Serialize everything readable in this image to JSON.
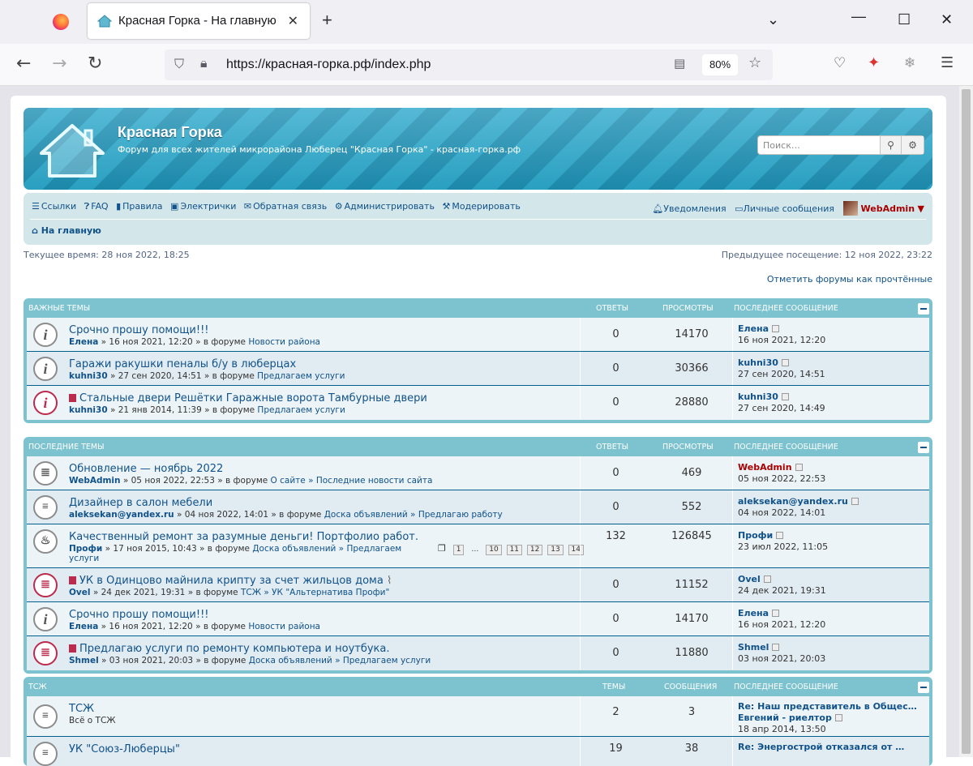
{
  "browser": {
    "tab_title": "Красная Горка - На главную",
    "url": "https://красная-горка.рф/index.php",
    "zoom": "80%"
  },
  "site": {
    "title": "Красная Горка",
    "description": "Форум для всех жителей микрорайона Люберец \"Красная Горка\" - красная-горка.рф",
    "search_placeholder": "Поиск…"
  },
  "nav": {
    "left": [
      "Ссылки",
      "FAQ",
      "Правила",
      "Электрички",
      "Обратная связь",
      "Администрировать",
      "Модерировать"
    ],
    "notifications": "Уведомления",
    "messages": "Личные сообщения",
    "user": "WebAdmin",
    "breadcrumb": "На главную"
  },
  "meta": {
    "current_time": "Текущее время: 28 ноя 2022, 18:25",
    "last_visit": "Предыдущее посещение: 12 ноя 2022, 23:22",
    "mark_read": "Отметить форумы как прочтённые"
  },
  "important": {
    "header": "Важные темы",
    "col1": "Ответы",
    "col2": "Просмотры",
    "col3": "Последнее сообщение",
    "rows": [
      {
        "title": "Срочно прошу помощи!!!",
        "author": "Елена",
        "info": " » 16 ноя 2021, 12:20 » в форуме ",
        "forum": "Новости района",
        "replies": "0",
        "views": "14170",
        "last_user": "Елена",
        "last_date": "16 ноя 2021, 12:20"
      },
      {
        "title": "Гаражи ракушки пеналы б/у в люберцах",
        "author": "kuhni30",
        "info": " » 27 сен 2020, 14:51 » в форуме ",
        "forum": "Предлагаем услуги",
        "replies": "0",
        "views": "30366",
        "last_user": "kuhni30",
        "last_date": "27 сен 2020, 14:51"
      },
      {
        "title": "Стальные двери Решётки Гаражные ворота Тамбурные двери",
        "author": "kuhni30",
        "info": " » 21 янв 2014, 11:39 » в форуме ",
        "forum": "Предлагаем услуги",
        "replies": "0",
        "views": "28880",
        "last_user": "kuhni30",
        "last_date": "27 сен 2020, 14:49"
      }
    ]
  },
  "recent": {
    "header": "Последние темы",
    "col1": "Ответы",
    "col2": "Просмотры",
    "col3": "Последнее сообщение",
    "rows": [
      {
        "title": "Обновление — ноябрь 2022",
        "author": "WebAdmin",
        "info": " » 05 ноя 2022, 22:53 » в форуме ",
        "forum": "О сайте » Последние новости сайта",
        "replies": "0",
        "views": "469",
        "last_user": "WebAdmin",
        "last_date": "05 ноя 2022, 22:53"
      },
      {
        "title": "Дизайнер в салон мебели",
        "author": "aleksekan@yandex.ru",
        "info": " » 04 ноя 2022, 14:01 » в форуме ",
        "forum": "Доска объявлений » Предлагаю работу",
        "replies": "0",
        "views": "552",
        "last_user": "aleksekan@yandex.ru",
        "last_date": "04 ноя 2022, 14:01"
      },
      {
        "title": "Качественный ремонт за разумные деньги! Портфолио работ.",
        "author": "Профи",
        "info": " » 17 ноя 2015, 10:43 » в форуме ",
        "forum": "Доска объявлений » Предлагаем",
        "forum2": "услуги",
        "pages": [
          "1",
          "…",
          "10",
          "11",
          "12",
          "13",
          "14"
        ],
        "replies": "132",
        "views": "126845",
        "last_user": "Профи",
        "last_date": "23 июл 2022, 11:05"
      },
      {
        "title": "УК в Одинцово майнила крипту за счет жильцов дома",
        "author": "Ovel",
        "info": " » 24 дек 2021, 19:31 » в форуме ",
        "forum": "ТСЖ » УК \"Альтернатива Профи\"",
        "replies": "0",
        "views": "11152",
        "last_user": "Ovel",
        "last_date": "24 дек 2021, 19:31"
      },
      {
        "title": "Срочно прошу помощи!!!",
        "author": "Елена",
        "info": " » 16 ноя 2021, 12:20 » в форуме ",
        "forum": "Новости района",
        "replies": "0",
        "views": "14170",
        "last_user": "Елена",
        "last_date": "16 ноя 2021, 12:20"
      },
      {
        "title": "Предлагаю услуги по ремонту компьютера и ноутбука.",
        "author": "Shmel",
        "info": " » 03 ноя 2021, 20:03 » в форуме ",
        "forum": "Доска объявлений » Предлагаем услуги",
        "replies": "0",
        "views": "11880",
        "last_user": "Shmel",
        "last_date": "03 ноя 2021, 20:03"
      }
    ]
  },
  "tsj": {
    "header": "ТСЖ",
    "col1": "Темы",
    "col2": "Сообщения",
    "col3": "Последнее сообщение",
    "rows": [
      {
        "title": "ТСЖ",
        "desc": "Всё о ТСЖ",
        "topics": "2",
        "posts": "3",
        "last_title": "Re: Наш представитель в Общес…",
        "last_user": "Евгений - риелтор",
        "last_date": "18 апр 2014, 13:50"
      },
      {
        "title": "УК \"Союз-Люберцы\"",
        "topics": "19",
        "posts": "38",
        "last_title": "Re: Энергострой отказался от …"
      }
    ]
  }
}
